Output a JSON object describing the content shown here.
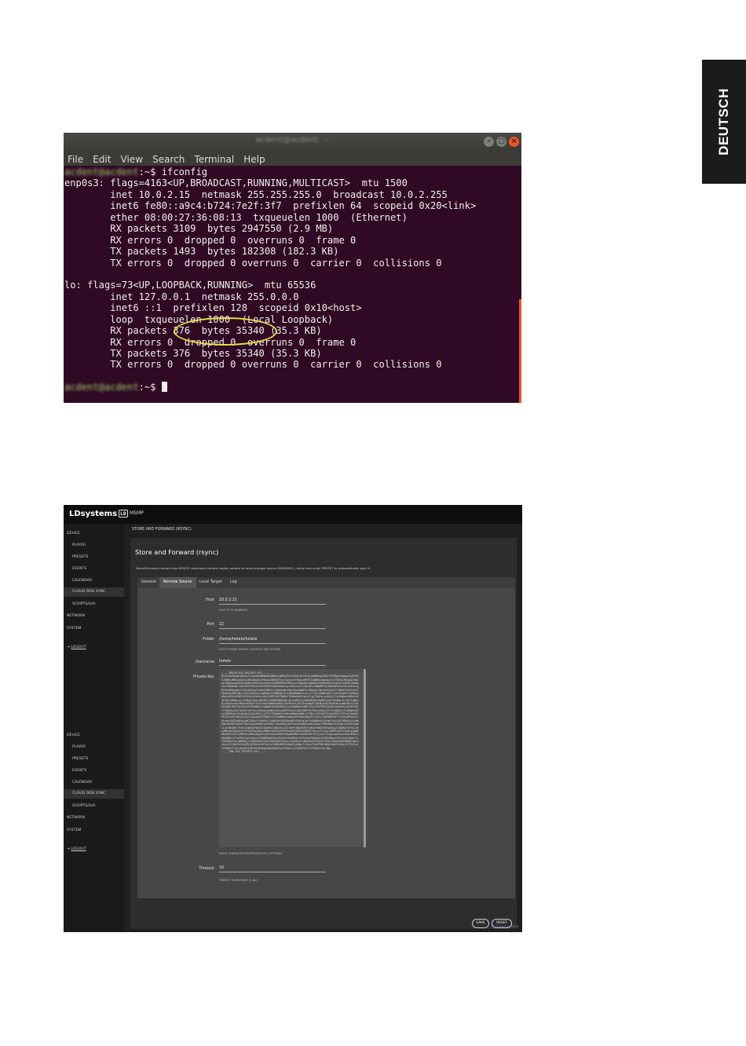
{
  "side_tab": "DEUTSCH",
  "terminal": {
    "window_title": "acdent@acdent: ~",
    "window_buttons": {
      "minimize": "–",
      "maximize": "□",
      "close": "×"
    },
    "menu": [
      "File",
      "Edit",
      "View",
      "Search",
      "Terminal",
      "Help"
    ],
    "user_host": "acdent@acdent",
    "prompt_suffix": ":~$ ",
    "command": "ifconfig",
    "lines": [
      "enp0s3: flags=4163<UP,BROADCAST,RUNNING,MULTICAST>  mtu 1500",
      "        inet 10.0.2.15  netmask 255.255.255.0  broadcast 10.0.2.255",
      "        inet6 fe80::a9c4:b724:7e2f:3f7  prefixlen 64  scopeid 0x20<link>",
      "        ether 08:00:27:36:08:13  txqueuelen 1000  (Ethernet)",
      "        RX packets 3109  bytes 2947550 (2.9 MB)",
      "        RX errors 0  dropped 0  overruns 0  frame 0",
      "        TX packets 1493  bytes 182308 (182.3 KB)",
      "        TX errors 0  dropped 0 overruns 0  carrier 0  collisions 0",
      "",
      "lo: flags=73<UP,LOOPBACK,RUNNING>  mtu 65536",
      "        inet 127.0.0.1  netmask 255.0.0.0",
      "        inet6 ::1  prefixlen 128  scopeid 0x10<host>",
      "        loop  txqueuelen 1000  (Local Loopback)",
      "        RX packets 376  bytes 35340 (35.3 KB)",
      "        RX errors 0  dropped 0  overruns 0  frame 0",
      "        TX packets 376  bytes 35340 (35.3 KB)",
      "        TX errors 0  dropped 0 overruns 0  carrier 0  collisions 0",
      ""
    ]
  },
  "webui": {
    "brand": "LDsystems",
    "brand_mark": "LD",
    "product": "MSMP",
    "sidebar_top": [
      {
        "label": "DEVICE",
        "level": "main"
      },
      {
        "label": "PLAYER",
        "level": "sub"
      },
      {
        "label": "PRESETS",
        "level": "sub"
      },
      {
        "label": "EVENTS",
        "level": "sub"
      },
      {
        "label": "CALENDAR",
        "level": "sub"
      },
      {
        "label": "CLOUD DISK SYNC",
        "level": "sub",
        "active": true
      },
      {
        "label": "SCRIPTS/LUA",
        "level": "sub"
      },
      {
        "label": "NETWORK",
        "level": "main"
      },
      {
        "label": "SYSTEM",
        "level": "main"
      }
    ],
    "sidebar_bottom": [
      {
        "label": "DEVICE",
        "level": "main"
      },
      {
        "label": "PLAYER",
        "level": "sub"
      },
      {
        "label": "PRESETS",
        "level": "sub"
      },
      {
        "label": "EVENTS",
        "level": "sub"
      },
      {
        "label": "CALENDAR",
        "level": "sub"
      },
      {
        "label": "CLOUD DISK SYNC",
        "level": "sub",
        "active": true
      },
      {
        "label": "SCRIPTS/LUA",
        "level": "sub"
      },
      {
        "label": "NETWORK",
        "level": "main"
      },
      {
        "label": "SYSTEM",
        "level": "main"
      }
    ],
    "logout": "LOGOUT",
    "breadcrumb": "STORE AND FORWARD (RSYNC)",
    "heading": "Store and Forward (rsync)",
    "description": "Store&Forward module lets DEVICE download remote media content to local storage device (SD/EMMC), delay and recall PRESET to automatically play it.",
    "tabs": [
      "General",
      "Remote Source",
      "Local Target",
      "Log"
    ],
    "active_tab": "Remote Source",
    "form": {
      "host_label": "Host",
      "host_value": "10.0.2.15",
      "host_help": "HOST IP OF ADDRESS",
      "port_label": "Port",
      "port_value": "22",
      "folder_label": "Folder",
      "folder_value": "/home/hotelo/hotelo",
      "folder_help": "HOST FOLDER WHERE CONTENTS ARE STORED",
      "username_label": "Username",
      "username_value": "hotelo",
      "key_label": "Private Key",
      "key_begin": "-----BEGIN RSA PRIVATE KEY-----",
      "key_body": "MIIEowIBAAKCAQEAvTjhsQ9eSBMNm9p3BKDwJgBPaZXZzFs6dxVbIXCoKjKWRBtbqJRQfJ9YBQpGvOaqwKLgFRYmbJ9RRn2NRp4oEyZwuK6zWSG8x4fNzmoJRBd9Jfxu7zgy4z7eT0ayxKMTPInB8MAvOdebpsFx7YNeh2JBXgdZ1Bn3atS8Qdxwnp6PGhsOm8rwJ9EiRaxOJeRzTwnMB5P6UXfMKCwx2Z6pu0o1sWdO8n5UeMeV8ZlkjOtk9rFmaKJ3DaWwIhzf6GUDdmr2aVZFbF5JAVsnrRCYMuB7U5QoPaSAcxy7x8zLnJkTv2Du9Vcr6WpMb7VyuMDeQH3sKuYwcxx0hLhgNTVpfWkbqyHfCYZbxHXHJpUfdQe9rMRGFcTpByKnNpYd9pZ5uSmBWfnrHQu8pL7WxVaYkZqv7TxRBnEIHvGYx5zYSBomOGv0B15WjJCSOCAQEAprVnq8hRmt5jNWhHeE4vYvBqwRmMaPs7yLjfT1xCJdkWtQeR+7L0YwZdQeTtsM56pSkKovw9GUr6VNfLHF4Vo3cEaYmLnQ4i2bPEr0kTZW6uPTDx0a8aeFzgtsFjgC2G6fw+uxK8zLTjbJeNbxtGW9cXo4dRJKo1HRNnxdcv1RBmgTpQvCaWTBS1rU8bBEMgUEq6+kOfjm85XZy4wM2WZ9bfOqRBTxhKF7KwNbLGcr9EtTgMeuHjJ6dpFsoRvXMZbn93a3CrhLkf5bEJVWmD6nB0Ayl8w3Hz5vjOP1AcHzWg9F2OhWsAfBjH4UEdmJcqWY9oLGj9gtQLA0Bs2MnTkHsZ5h4YoRkdB8tTcQpW8KyM29bLRAqCvwtZmUHg5VsW0CIYAx3ZbTPBZiRxDy2aQ6eRnJqCA0rXkCrFV8D3hxGUn7m5DkrePlDn/0uRnbvzRdB1v6VLAq96FRfewYxQUZZRPt3sTR2uI4AdjI2lYVsNUD2t7v5BqWCn6FwjTWE80oZcZnXUvWs2YADiZ6h7jwE7EtTQ9gWXoFjN8uA0Mqkk9NdxjCFMuf/HTC6hFVZiHyMGoTtFPk4Z/WaUdlRUJ3tLb8YJWh4lAlA1jbAkaKgTRb9DRs1GLZpMWSpwcNp4wJPh2Wss0qhZFsJyP+tZmYRmM/WfTY1iNsq69o44vCbLn0w1OGZGm84AcpW7XUQsYFVbHXRrJ1e8KQMrtBG5bhm8ZzFQe2g1ov7w3wNbkAtXzGq8j5yX+BTkMQFpGzSyRm9m6chF8M7sB0aTYQkSLZxeVHqK7dnP4mBYr2qLUE0yc6kTnaZwRy8HkqGmCp0Xg7JPBXdNqL9tQ3aFvfA2RZjKwWiLxhvMuD8TyFe5s2GbN4hPk0U1tQSqRbLGd6wTaL3ZCvNcP1BDAEm9fYjWdJYkN02VhTsUmIgJxQR8Kp7cF4xLZ5eyMb+Hn3AavD2tr6fGk5PqJsWjLRNbeVc0EXy9cFB1Go8nQtMZkS2UWDVLzmtyuJY+XA/hd0PI4q7FcsRKxa3pNGbHnUZwYoE5fy8BI6tJMd1LQeg2ScyDVv4XSaTNcRfQKpWb3MkEzoG0IFRhr9VjyZxx7CtguLpdiA1ksUOeJN7mYnHbq5W2ivTfaGFmlXg3e8yhLsPzB4RKwNSdQj0ZcUoVxMc8Rtg7lKfy4nEJWp6abs2IhDYGHq+F5u1uXzZvOAiTnLcPkQ9mtS3xrN8RBkjL2e0DoYWeG1h4fC6UsMqVTaJgyz7pZ5b+HrsNwd3kvtF9XyP2lEGLiuOQCmRAt0BZ8YqQrpnhxcJI7yWfVkIdaSMjG4TNuUs3eT1oLhZlWM3vDR9zvQpKEyn6gcfiYoa+F5AGPXBr0bNJCmk2t8uQ+VcT3hSLexs9IWRwY7fglzDpUqTjMO1R4ZAaKgyfNv6hBdS2wLP5HoJc+VXk8eFEmt7yTQ30uiIRrGbp",
      "key_end": "-----END RSA PRIVATE KEY-----",
      "key_help": "PASTE GENERATED RSA PRIVATE KEY (OPTIONAL)",
      "timeout_label": "Timeout",
      "timeout_value": "10",
      "timeout_help": "TIMEOUT IN SECONDS [5..60]"
    },
    "buttons": {
      "save": "SAVE",
      "reset": "RESET"
    },
    "footer": {
      "link": "LD Systems",
      "sep": " / ",
      "version": "1.0.0"
    }
  }
}
